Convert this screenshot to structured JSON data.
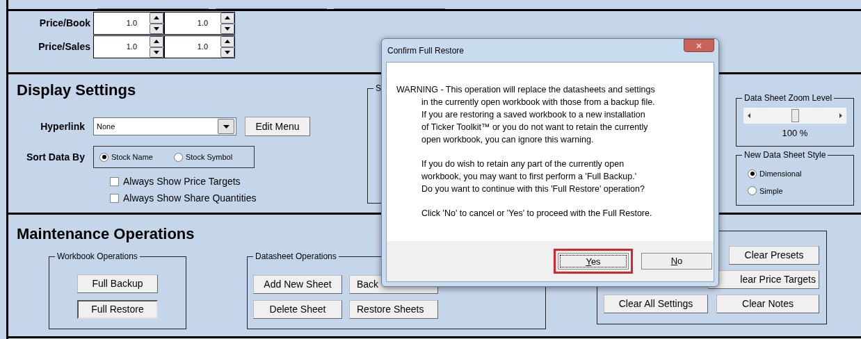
{
  "ratios": {
    "rows": [
      {
        "label": "Price/Book",
        "values": [
          "1.0",
          "1.0"
        ]
      },
      {
        "label": "Price/Sales",
        "values": [
          "1.0",
          "1.0"
        ]
      }
    ]
  },
  "display_settings": {
    "title": "Display Settings",
    "hyperlink": {
      "label": "Hyperlink",
      "value": "None"
    },
    "edit_menu_button": "Edit Menu",
    "sort": {
      "label": "Sort Data By",
      "options": [
        {
          "label": "Stock Name",
          "selected": true
        },
        {
          "label": "Stock Symbol",
          "selected": false
        }
      ]
    },
    "checkboxes": [
      {
        "label": "Always Show Price Targets",
        "checked": false
      },
      {
        "label": "Always Show Share Quantities",
        "checked": false
      }
    ],
    "group_box": {
      "title": "S"
    },
    "zoom": {
      "title": "Data Sheet Zoom Level",
      "level": 0.5,
      "reading": "100 %"
    },
    "sheet_style": {
      "title": "New Data Sheet Style",
      "options": [
        {
          "label": "Dimensional",
          "selected": true
        },
        {
          "label": "Simple",
          "selected": false
        }
      ]
    }
  },
  "maintenance": {
    "title": "Maintenance Operations",
    "workbook": {
      "title": "Workbook Operations",
      "buttons": [
        {
          "label": "Full Backup",
          "pressed": false
        },
        {
          "label": "Full Restore",
          "pressed": true
        }
      ]
    },
    "datasheet": {
      "title": "Datasheet Operations",
      "buttons": [
        {
          "label": "Add New Sheet",
          "pressed": false
        },
        {
          "label": "Back",
          "pressed": false
        },
        {
          "label": "Delete Sheet",
          "pressed": false
        },
        {
          "label": "Restore Sheets",
          "pressed": false
        }
      ]
    },
    "clear": {
      "column_buttons": [
        {
          "label": "Clear Presets",
          "pressed": false
        },
        {
          "label": "lear Price Targets",
          "pressed": false
        }
      ],
      "bottom_buttons": [
        {
          "label": "Clear All Settings",
          "pressed": false
        },
        {
          "label": "Clear Notes",
          "pressed": false
        }
      ]
    }
  },
  "dialog": {
    "title": "Confirm Full Restore",
    "paragraphs": [
      {
        "kind": "hanging",
        "lines": [
          "WARNING - This operation will replace the datasheets and settings",
          "in the currently open workbook with those from a backup file.",
          "If you are restoring a saved workbook to a new installation",
          "of Ticker Toolkit™ or you do not want to retain the currently",
          "open workbook, you can ignore this warning."
        ]
      },
      {
        "kind": "indented",
        "lines": [
          "If you do wish to retain any part of the currently open",
          "workbook, you may want to first perform a 'Full Backup.'",
          "Do you want to continue with this 'Full Restore' operation?"
        ]
      },
      {
        "kind": "indented",
        "lines": [
          "Click 'No' to cancel or 'Yes' to proceed with the Full Restore."
        ]
      }
    ],
    "buttons": [
      {
        "label": "Yes",
        "focused": true,
        "highlighted": true
      },
      {
        "label": "No",
        "focused": false,
        "highlighted": false
      }
    ]
  }
}
